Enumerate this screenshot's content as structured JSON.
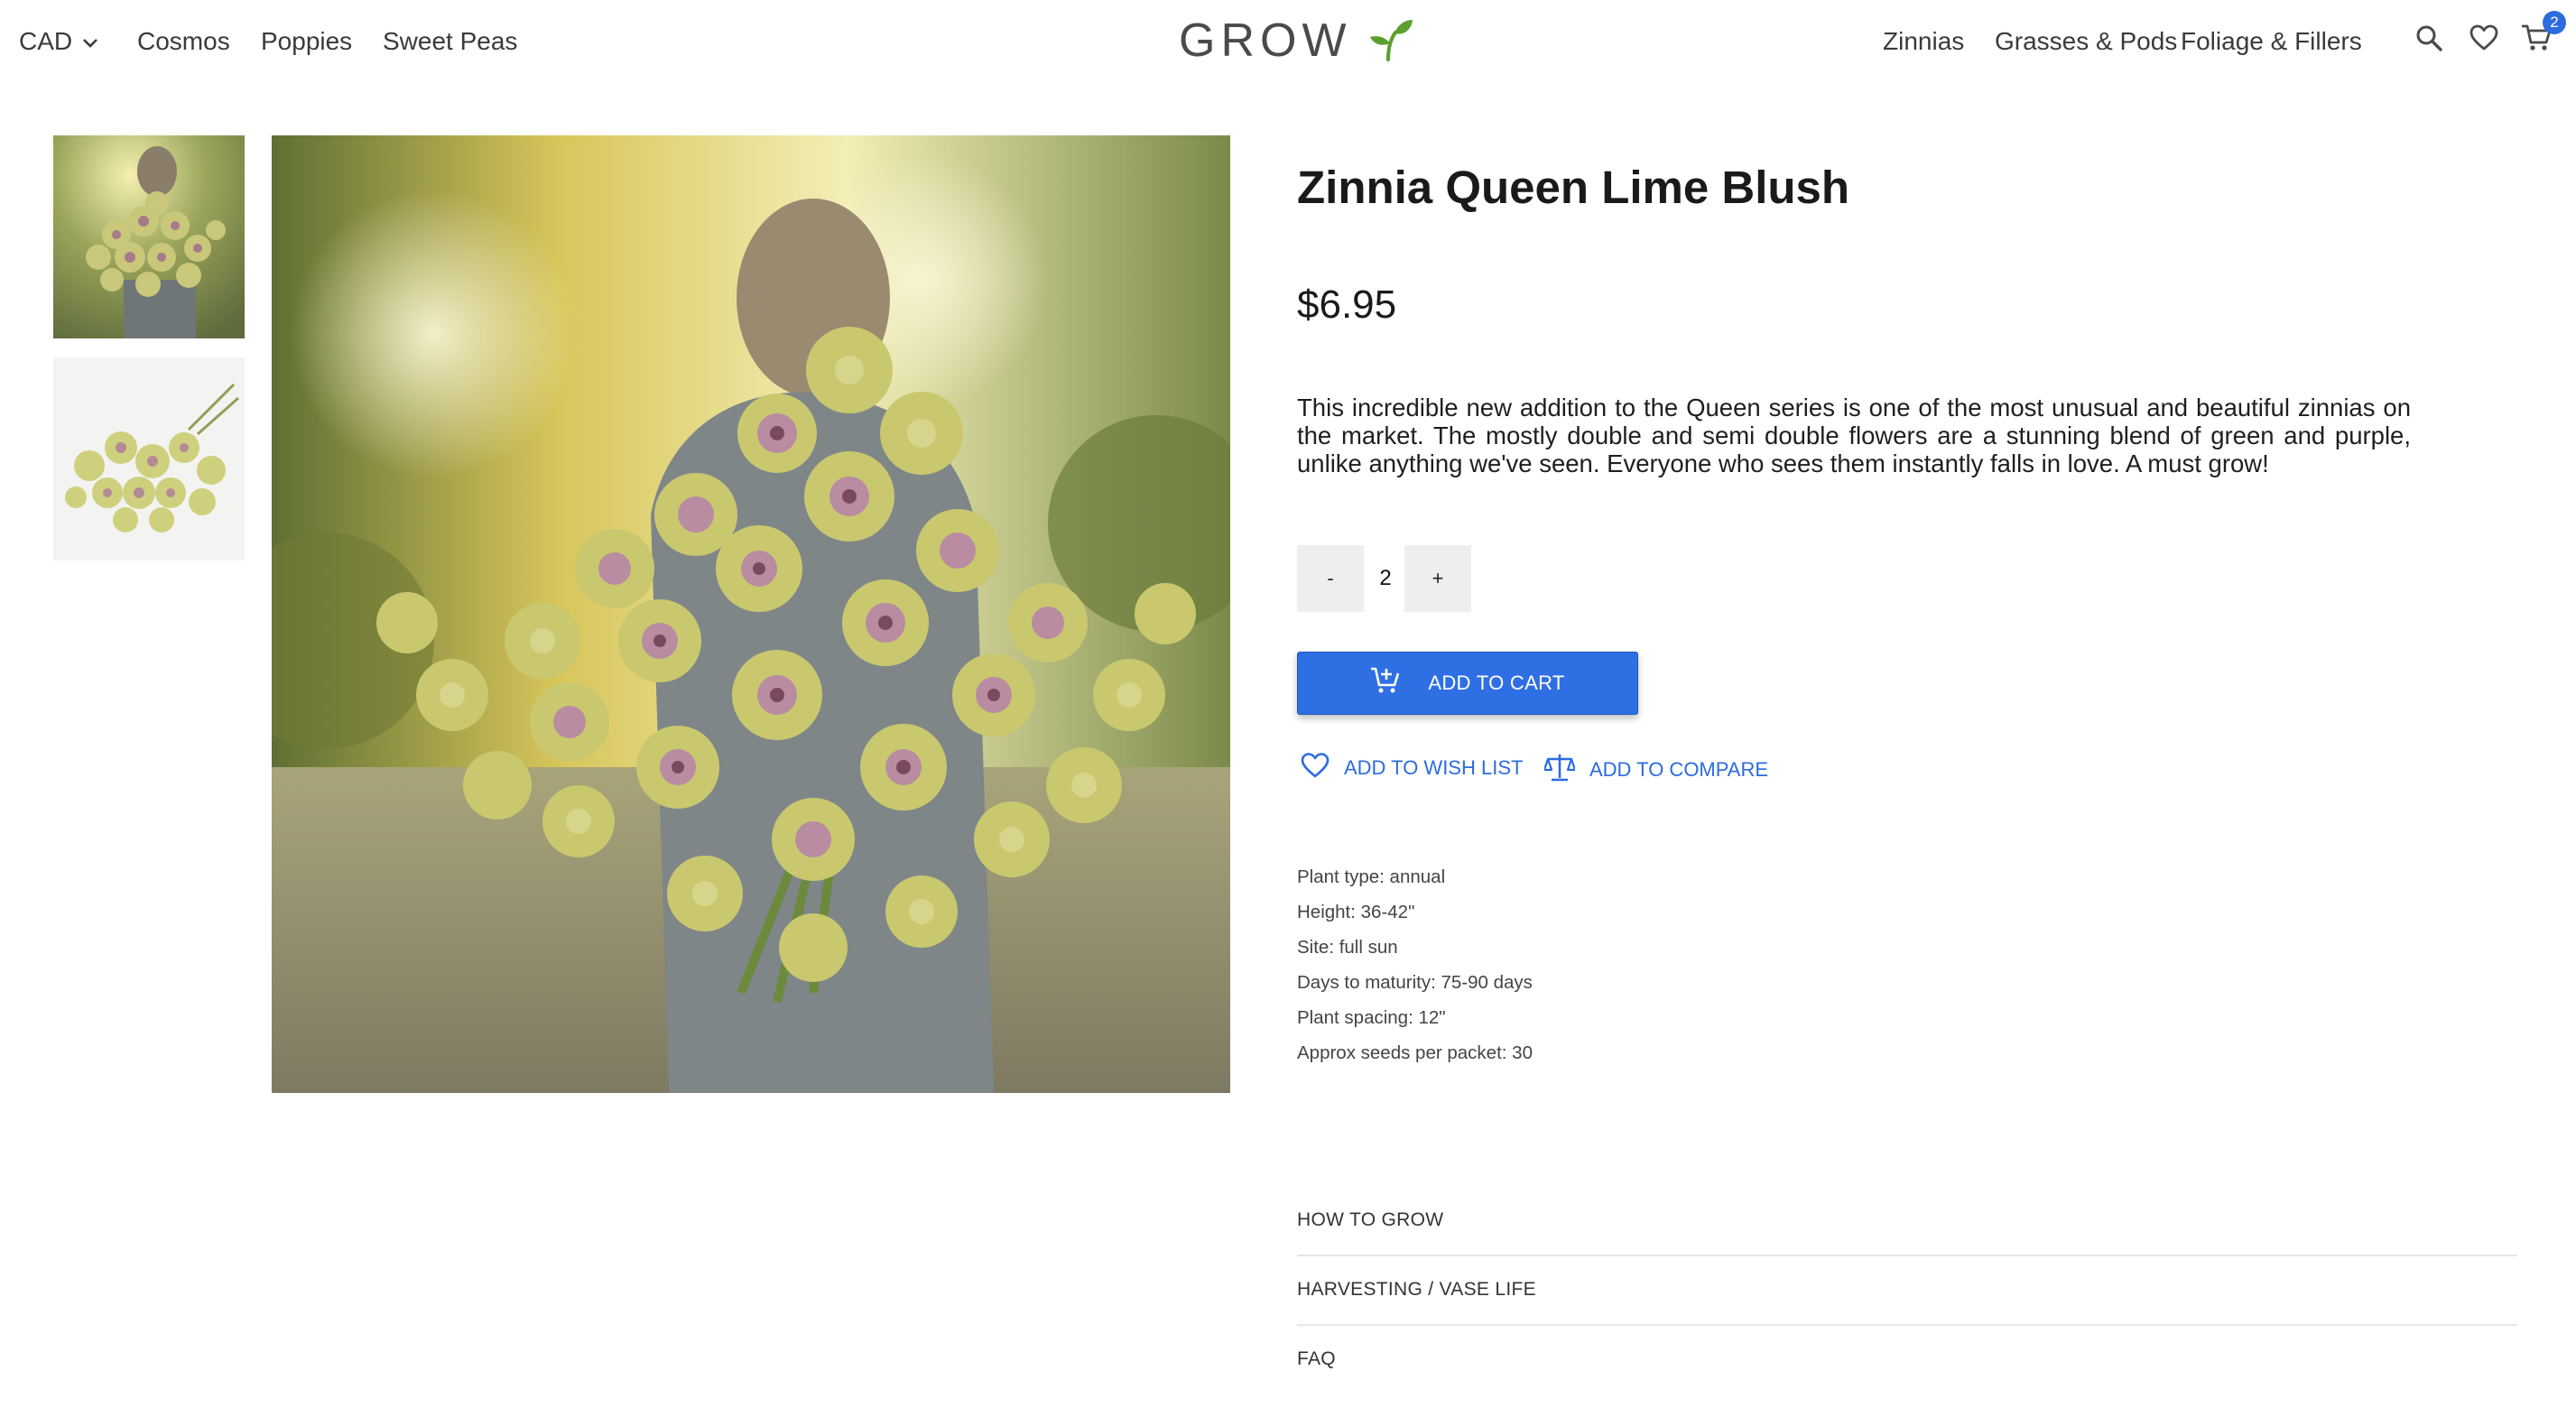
{
  "header": {
    "currency": "CAD",
    "left_nav": [
      "Cosmos",
      "Poppies",
      "Sweet Peas"
    ],
    "logo_text": "GROW",
    "right_nav": [
      "Zinnias",
      "Grasses & Pods",
      "Foliage & Fillers"
    ],
    "cart_count": "2",
    "icons": [
      "search-icon",
      "heart-icon",
      "cart-icon"
    ]
  },
  "gallery": {
    "thumbnails": [
      "bouquet-held-thumbnail",
      "zinnias-laid-flat-thumbnail"
    ],
    "main_image": "bouquet-held-photo"
  },
  "product": {
    "title": "Zinnia Queen Lime Blush",
    "price": "$6.95",
    "description": "This incredible new addition to the Queen series is one of the most unusual and beautiful zinnias on the market. The mostly double and semi double flowers are a stunning blend of green and purple, unlike anything we've seen. Everyone who sees them instantly falls in love. A must grow!",
    "quantity": {
      "decrement": "-",
      "value": "2",
      "increment": "+"
    },
    "add_to_cart": "ADD TO CART",
    "add_to_wishlist": "ADD TO WISH LIST",
    "add_to_compare": "ADD TO COMPARE",
    "specs": [
      "Plant type: annual",
      "Height: 36-42\"",
      "Site: full sun",
      "Days to maturity: 75-90 days",
      "Plant spacing: 12\"",
      "Approx seeds per packet: 30"
    ],
    "accordion": [
      "HOW TO GROW",
      "HARVESTING / VASE LIFE",
      "FAQ"
    ]
  },
  "colors": {
    "accent": "#2f6fe4",
    "link": "#2c6be0",
    "sprout": "#5aa02c"
  }
}
